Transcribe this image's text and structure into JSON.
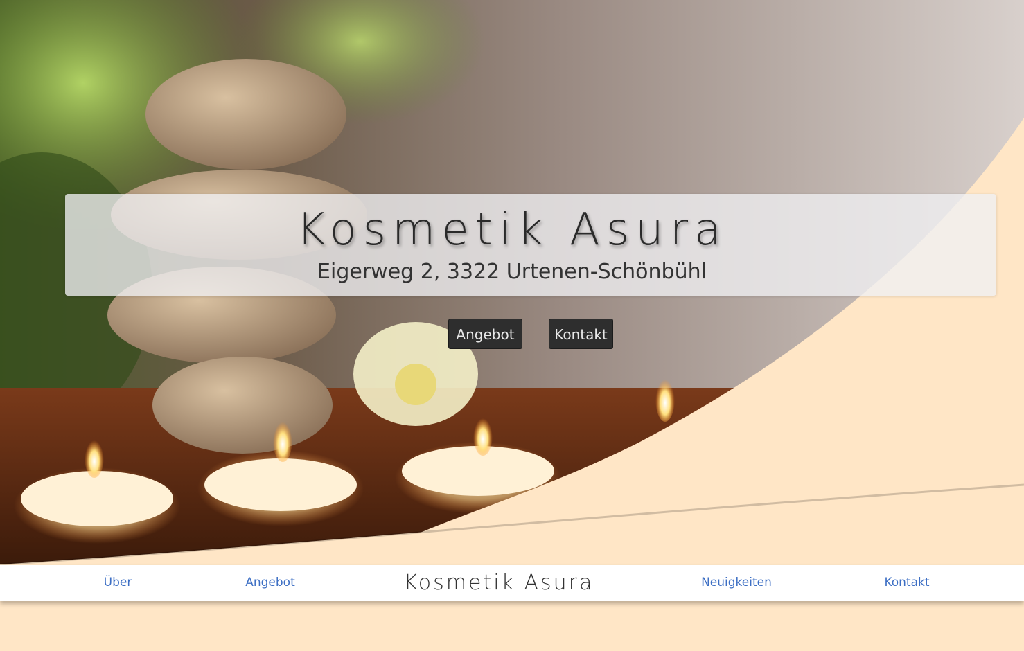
{
  "hero": {
    "title": "Kosmetik Asura",
    "address": "Eigerweg 2, 3322 Urtenen-Schönbühl",
    "buttons": {
      "angebot": "Angebot",
      "kontakt": "Kontakt"
    }
  },
  "nav": {
    "items": [
      {
        "label": "Über"
      },
      {
        "label": "Angebot"
      },
      {
        "label": "Neuigkeiten"
      },
      {
        "label": "Kontakt"
      }
    ],
    "brand": "Kosmetik Asura"
  },
  "colors": {
    "accent": "#ffe6c6",
    "link": "#3d6fc4",
    "button_bg": "#2e2e2e"
  }
}
